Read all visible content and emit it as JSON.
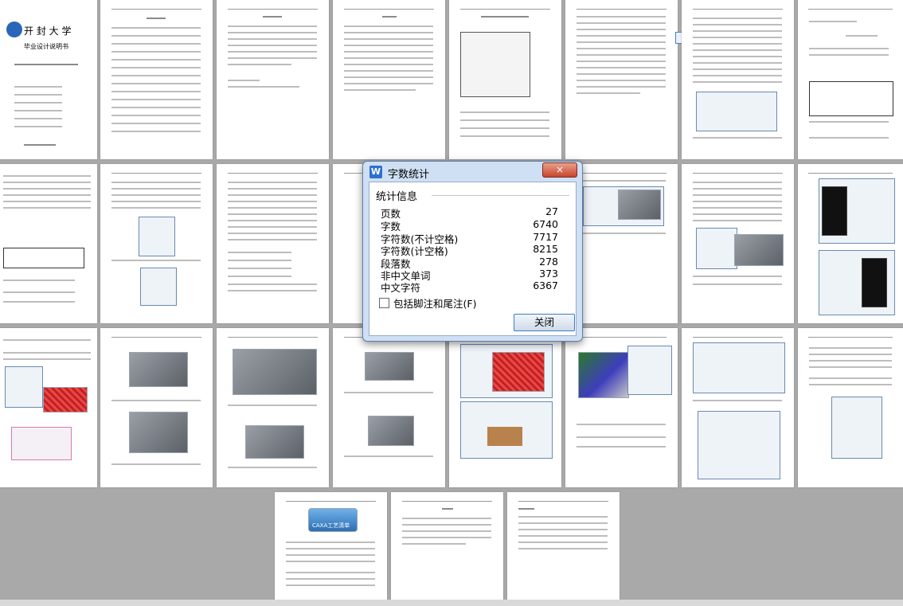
{
  "dialog": {
    "title": "字数统计",
    "close_label": "×",
    "section_title": "统计信息",
    "stats": [
      {
        "label": "页数",
        "value": "27"
      },
      {
        "label": "字数",
        "value": "6740"
      },
      {
        "label": "字符数(不计空格)",
        "value": "7717"
      },
      {
        "label": "字符数(计空格)",
        "value": "8215"
      },
      {
        "label": "段落数",
        "value": "278"
      },
      {
        "label": "非中文单词",
        "value": "373"
      },
      {
        "label": "中文字符",
        "value": "6367"
      }
    ],
    "checkbox_label": "包括脚注和尾注(F)",
    "button_label": "关闭"
  },
  "cover": {
    "university": "开 封 大 学",
    "subtitle": "毕业设计说明书"
  },
  "caxa_label": "CAXA工艺清单"
}
